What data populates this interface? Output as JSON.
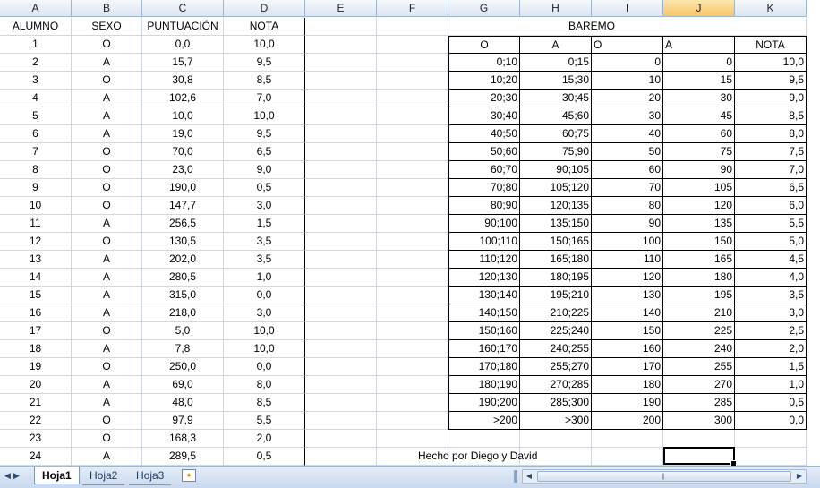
{
  "columns": [
    "A",
    "B",
    "C",
    "D",
    "E",
    "F",
    "G",
    "H",
    "I",
    "J",
    "K"
  ],
  "selected_column": "J",
  "header_row": [
    "ALUMNO",
    "SEXO",
    "PUNTUACIÓN",
    "NOTA"
  ],
  "students": [
    [
      "1",
      "O",
      "0,0",
      "10,0"
    ],
    [
      "2",
      "A",
      "15,7",
      "9,5"
    ],
    [
      "3",
      "O",
      "30,8",
      "8,5"
    ],
    [
      "4",
      "A",
      "102,6",
      "7,0"
    ],
    [
      "5",
      "A",
      "10,0",
      "10,0"
    ],
    [
      "6",
      "A",
      "19,0",
      "9,5"
    ],
    [
      "7",
      "O",
      "70,0",
      "6,5"
    ],
    [
      "8",
      "O",
      "23,0",
      "9,0"
    ],
    [
      "9",
      "O",
      "190,0",
      "0,5"
    ],
    [
      "10",
      "O",
      "147,7",
      "3,0"
    ],
    [
      "11",
      "A",
      "256,5",
      "1,5"
    ],
    [
      "12",
      "O",
      "130,5",
      "3,5"
    ],
    [
      "13",
      "A",
      "202,0",
      "3,5"
    ],
    [
      "14",
      "A",
      "280,5",
      "1,0"
    ],
    [
      "15",
      "A",
      "315,0",
      "0,0"
    ],
    [
      "16",
      "A",
      "218,0",
      "3,0"
    ],
    [
      "17",
      "O",
      "5,0",
      "10,0"
    ],
    [
      "18",
      "A",
      "7,8",
      "10,0"
    ],
    [
      "19",
      "O",
      "250,0",
      "0,0"
    ],
    [
      "20",
      "A",
      "69,0",
      "8,0"
    ],
    [
      "21",
      "A",
      "48,0",
      "8,5"
    ],
    [
      "22",
      "O",
      "97,9",
      "5,5"
    ],
    [
      "23",
      "O",
      "168,3",
      "2,0"
    ],
    [
      "24",
      "A",
      "289,5",
      "0,5"
    ]
  ],
  "baremo": {
    "title": "BAREMO",
    "headers": [
      "O",
      "A",
      "O",
      "A",
      "NOTA"
    ],
    "rows": [
      [
        "0;10",
        "0;15",
        "0",
        "0",
        "10,0"
      ],
      [
        "10;20",
        "15;30",
        "10",
        "15",
        "9,5"
      ],
      [
        "20;30",
        "30;45",
        "20",
        "30",
        "9,0"
      ],
      [
        "30;40",
        "45;60",
        "30",
        "45",
        "8,5"
      ],
      [
        "40;50",
        "60;75",
        "40",
        "60",
        "8,0"
      ],
      [
        "50;60",
        "75;90",
        "50",
        "75",
        "7,5"
      ],
      [
        "60;70",
        "90;105",
        "60",
        "90",
        "7,0"
      ],
      [
        "70;80",
        "105;120",
        "70",
        "105",
        "6,5"
      ],
      [
        "80;90",
        "120;135",
        "80",
        "120",
        "6,0"
      ],
      [
        "90;100",
        "135;150",
        "90",
        "135",
        "5,5"
      ],
      [
        "100;110",
        "150;165",
        "100",
        "150",
        "5,0"
      ],
      [
        "110;120",
        "165;180",
        "110",
        "165",
        "4,5"
      ],
      [
        "120;130",
        "180;195",
        "120",
        "180",
        "4,0"
      ],
      [
        "130;140",
        "195;210",
        "130",
        "195",
        "3,5"
      ],
      [
        "140;150",
        "210;225",
        "140",
        "210",
        "3,0"
      ],
      [
        "150;160",
        "225;240",
        "150",
        "225",
        "2,5"
      ],
      [
        "160;170",
        "240;255",
        "160",
        "240",
        "2,0"
      ],
      [
        "170;180",
        "255;270",
        "170",
        "255",
        "1,5"
      ],
      [
        "180;190",
        "270;285",
        "180",
        "270",
        "1,0"
      ],
      [
        "190;200",
        "285;300",
        "190",
        "285",
        "0,5"
      ],
      [
        ">200",
        ">300",
        "200",
        "300",
        "0,0"
      ]
    ]
  },
  "footer_note": "Hecho por Diego y David",
  "sheet_tabs": [
    "Hoja1",
    "Hoja2",
    "Hoja3"
  ],
  "active_tab": "Hoja1",
  "colors": {
    "header_bg": "#dde6f1",
    "selected_header": "#f7c468",
    "gridline": "#d0d7e5"
  }
}
